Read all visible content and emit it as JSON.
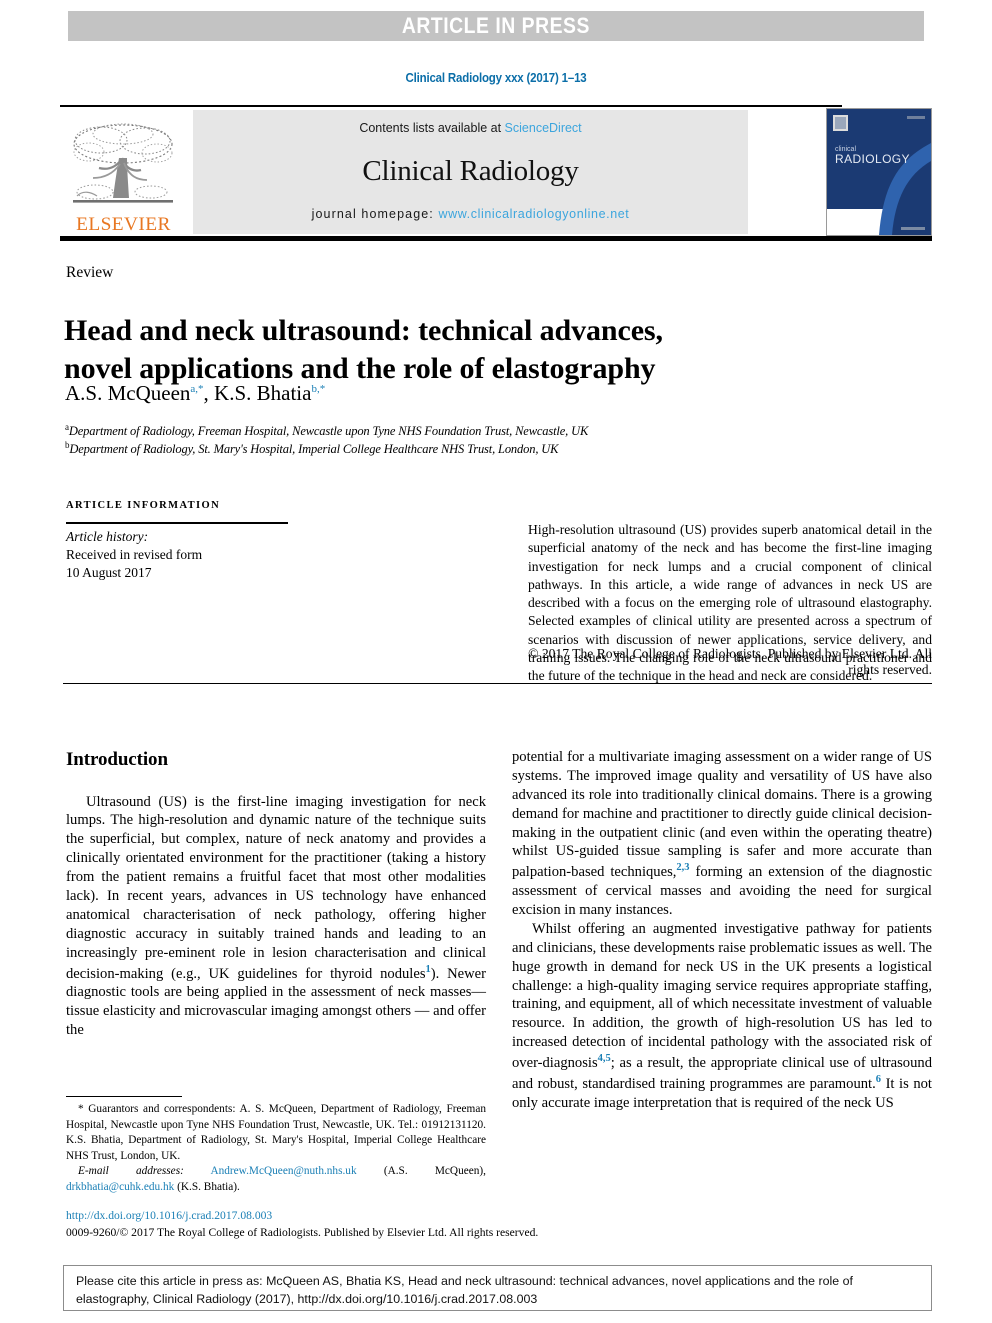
{
  "banner": {
    "text": "ARTICLE IN PRESS"
  },
  "running_head": {
    "text": "Clinical Radiology xxx (2017) 1–13",
    "color": "#0b6ea8"
  },
  "masthead": {
    "publisher": "ELSEVIER",
    "publisher_color": "#e87722",
    "contents_prefix": "Contents lists available at ",
    "contents_link": "ScienceDirect",
    "journal_name": "Clinical Radiology",
    "homepage_prefix": "journal homepage: ",
    "homepage_url": "www.clinicalradiologyonline.net",
    "link_color": "#3ca5dd",
    "cover_title_small": "clinical",
    "cover_title_large": "RADIOLOGY"
  },
  "article": {
    "type": "Review",
    "title": "Head and neck ultrasound: technical advances, novel applications and the role of elastography",
    "title_line1": "Head and neck ultrasound: technical advances,",
    "title_line2": "novel applications and the role of elastography",
    "authors_text": "A.S. McQueen",
    "author1": "A.S. McQueen",
    "author1_sup": "a,",
    "author2": "K.S. Bhatia",
    "author2_sup": "b,",
    "affiliation_a_marker": "a",
    "affiliation_a": "Department of Radiology, Freeman Hospital, Newcastle upon Tyne NHS Foundation Trust, Newcastle, UK",
    "affiliation_b_marker": "b",
    "affiliation_b": "Department of Radiology, St. Mary's Hospital, Imperial College Healthcare NHS Trust, London, UK"
  },
  "article_info": {
    "heading": "ARTICLE INFORMATION",
    "history_label": "Article history:",
    "history_line1": "Received in revised form",
    "history_line2": "10 August 2017"
  },
  "abstract": {
    "body": "High-resolution ultrasound (US) provides superb anatomical detail in the superficial anatomy of the neck and has become the first-line imaging investigation for neck lumps and a crucial component of clinical pathways. In this article, a wide range of advances in neck US are described with a focus on the emerging role of ultrasound elastography. Selected examples of clinical utility are presented across a spectrum of scenarios with discussion of newer applications, service delivery, and training issues. The changing role of the neck ultrasound practitioner and the future of the technique in the head and neck are considered.",
    "copyright": "© 2017 The Royal College of Radiologists. Published by Elsevier Ltd. All rights reserved."
  },
  "body": {
    "section_heading": "Introduction",
    "left_para_1a": "Ultrasound (US) is the first-line imaging investigation for neck lumps. The high-resolution and dynamic nature of the technique suits the superficial, but complex, nature of neck anatomy and provides a clinically orientated environment for the practitioner (taking a history from the patient remains a fruitful facet that most other modalities lack). In recent years, advances in US technology have enhanced anatomical characterisation of neck pathology, offering higher diagnostic accuracy in suitably trained hands and leading to an increasingly pre-eminent role in lesion characterisation and clinical decision-making (e.g., UK guidelines for thyroid nodules",
    "ref_1": "1",
    "left_para_1b": "). Newer diagnostic tools are being applied in the assessment of neck masses— tissue elasticity and microvascular imaging amongst others — and offer the",
    "right_para_1a": "potential for a multivariate imaging assessment on a wider range of US systems. The improved image quality and versatility of US have also advanced its role into traditionally clinical domains. There is a growing demand for machine and practitioner to directly guide clinical decision-making in the outpatient clinic (and even within the operating theatre) whilst US-guided tissue sampling is safer and more accurate than palpation-based techniques,",
    "ref_23": "2,3",
    "right_para_1b": " forming an extension of the diagnostic assessment of cervical masses and avoiding the need for surgical excision in many instances.",
    "right_para_2a": "Whilst offering an augmented investigative pathway for patients and clinicians, these developments raise problematic issues as well. The huge growth in demand for neck US in the UK presents a logistical challenge: a high-quality imaging service requires appropriate staffing, training, and equipment, all of which necessitate investment of valuable resource. In addition, the growth of high-resolution US has led to increased detection of incidental pathology with the associated risk of over-diagnosis",
    "ref_45": "4,5",
    "right_para_2b": "; as a result, the appropriate clinical use of ultrasound and robust, standardised training programmes are paramount.",
    "ref_6": "6",
    "right_para_2c": " It is not only accurate image interpretation that is required of the neck US"
  },
  "footnote": {
    "star": "*",
    "correspondence": " Guarantors and correspondents: A. S. McQueen, Department of Radiology, Freeman Hospital, Newcastle upon Tyne NHS Foundation Trust, Newcastle, UK. Tel.: 01912131120. K.S. Bhatia, Department of Radiology, St. Mary's Hospital, Imperial College Healthcare NHS Trust, London, UK.",
    "email_label": "E-mail addresses:",
    "email_1": "Andrew.McQueen@nuth.nhs.uk",
    "email_1_owner": " (A.S. McQueen), ",
    "email_2": "drkbhatia@cuhk.edu.hk",
    "email_2_owner": " (K.S. Bhatia)."
  },
  "footer": {
    "doi": "http://dx.doi.org/10.1016/j.crad.2017.08.003",
    "copyright": "0009-9260/© 2017 The Royal College of Radiologists. Published by Elsevier Ltd. All rights reserved.",
    "cite_notice": "Please cite this article in press as: McQueen AS, Bhatia KS, Head and neck ultrasound: technical advances, novel applications and the role of elastography, Clinical Radiology (2017), http://dx.doi.org/10.1016/j.crad.2017.08.003"
  }
}
